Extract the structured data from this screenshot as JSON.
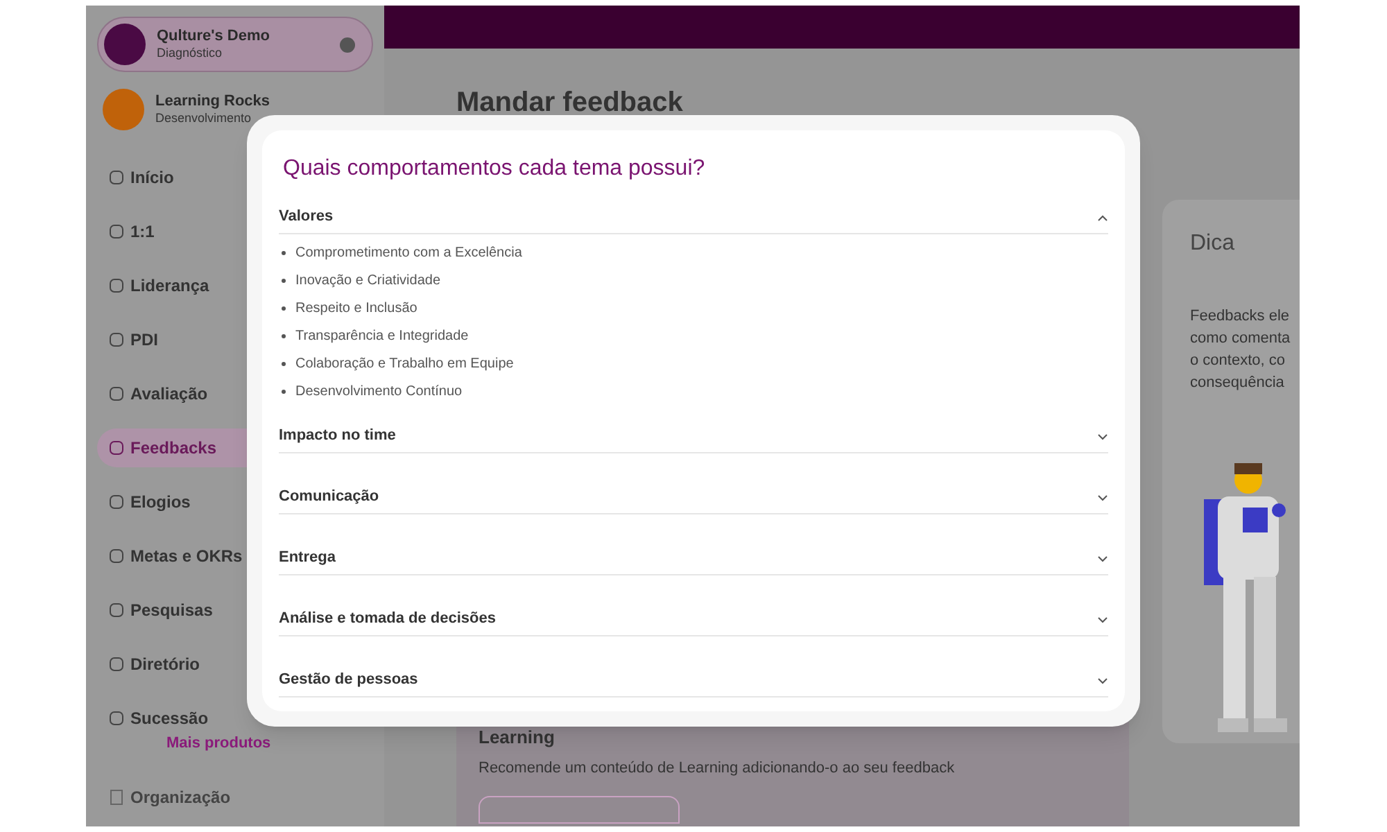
{
  "sidebar": {
    "workspaces": [
      {
        "name": "Qulture's Demo",
        "subtitle": "Diagnóstico",
        "selected": true,
        "color": "#4a0a44"
      },
      {
        "name": "Learning Rocks",
        "subtitle": "Desenvolvimento",
        "selected": false,
        "color": "#c0620a"
      }
    ],
    "items": [
      {
        "label": "Início",
        "selected": false
      },
      {
        "label": "1:1",
        "selected": false
      },
      {
        "label": "Liderança",
        "selected": false
      },
      {
        "label": "PDI",
        "selected": false
      },
      {
        "label": "Avaliação",
        "selected": false
      },
      {
        "label": "Feedbacks",
        "selected": true
      },
      {
        "label": "Elogios",
        "selected": false
      },
      {
        "label": "Metas e OKRs",
        "selected": false
      },
      {
        "label": "Pesquisas",
        "selected": false
      },
      {
        "label": "Diretório",
        "selected": false
      },
      {
        "label": "Sucessão",
        "selected": false
      }
    ],
    "more": "Mais produtos",
    "footer_item": "Organização"
  },
  "main": {
    "title": "Mandar feedback",
    "tip": {
      "title": "Dica",
      "lines": [
        "Feedbacks ele",
        "como comenta",
        "o contexto, co",
        "consequência"
      ]
    },
    "learning": {
      "title": "Learning",
      "text": "Recomende um conteúdo de Learning adicionando-o ao seu feedback"
    }
  },
  "modal": {
    "title": "Quais comportamentos cada tema possui?",
    "sections": [
      {
        "title": "Valores",
        "expanded": true,
        "items": [
          "Comprometimento com a Excelência",
          "Inovação e Criatividade",
          "Respeito e Inclusão",
          "Transparência e Integridade",
          "Colaboração e Trabalho em Equipe",
          "Desenvolvimento Contínuo"
        ]
      },
      {
        "title": "Impacto no time",
        "expanded": false
      },
      {
        "title": "Comunicação",
        "expanded": false
      },
      {
        "title": "Entrega",
        "expanded": false
      },
      {
        "title": "Análise e tomada de decisões",
        "expanded": false
      },
      {
        "title": "Gestão de pessoas",
        "expanded": false
      }
    ]
  }
}
